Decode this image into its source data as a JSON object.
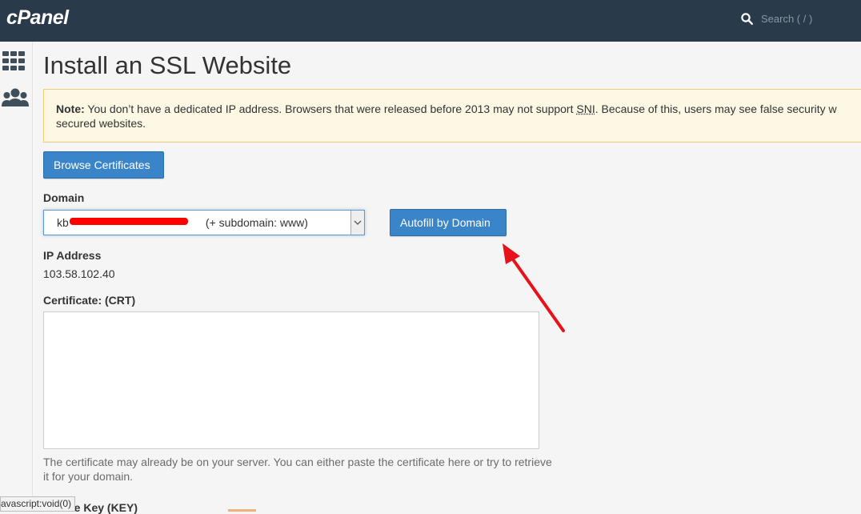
{
  "header": {
    "logo": "cPanel",
    "search_placeholder": "Search ( / )"
  },
  "sidebar": {
    "items": [
      {
        "icon": "grid-icon"
      },
      {
        "icon": "users-icon"
      }
    ]
  },
  "page": {
    "title": "Install an SSL Website",
    "note_label": "Note:",
    "note_line1": "You don’t have a dedicated IP address. Browsers that were released before 2013 may not support ",
    "note_sni": "SNI",
    "note_line1_end": ". Because of this, users may see false security w",
    "note_line2": "secured websites.",
    "browse_button": "Browse Certificates",
    "domain_label": "Domain",
    "domain_value": "kb                                            (+ subdomain: www)",
    "autofill_button": "Autofill by Domain",
    "ip_label": "IP Address",
    "ip_value": "103.58.102.40",
    "crt_label": "Certificate: (CRT)",
    "crt_value": "",
    "crt_help": "The certificate may already be on your server. You can either paste the certificate here or try to retrieve it for your domain.",
    "next_label_partial": "te Key (KEY)"
  },
  "status_bar": {
    "text": "avascript:void(0)"
  },
  "colors": {
    "topbar": "#293a4a",
    "button": "#3a85c9",
    "note_bg": "#fcf8e3",
    "annotation_arrow": "#e8121b"
  }
}
